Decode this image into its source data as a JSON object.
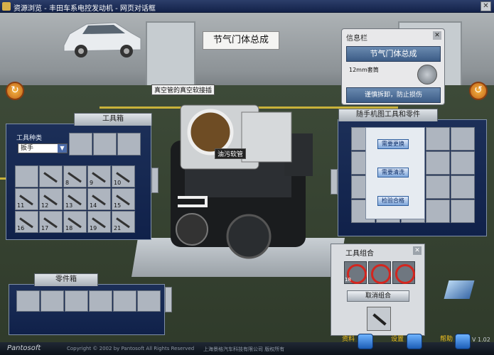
{
  "window": {
    "title": "资源浏览 - 丰田车系电控发动机 - 网页对话框",
    "close_glyph": "✕"
  },
  "assembly_title": "节气门体总成",
  "info_panel": {
    "title": "信息栏",
    "close_glyph": "✕",
    "part_name": "节气门体总成",
    "tool_spec": "12mm套筒",
    "warning": "谨慎拆卸，防止损伤"
  },
  "callouts": {
    "hose": "真空管的真空软接插",
    "connector": "油污软管"
  },
  "icons": {
    "left_round": "refresh-icon",
    "right_round": "rotate-icon"
  },
  "toolbox": {
    "title": "工具箱",
    "type_label": "工具种类",
    "type_selected": "扳手",
    "slot_numbers": [
      "",
      "",
      "8",
      "9",
      "10",
      "11",
      "12",
      "13",
      "14",
      "15",
      "16",
      "17",
      "18",
      "19",
      "21"
    ]
  },
  "hand_panel": {
    "title": "随手机图工具和零件",
    "buttons": [
      "需要更换",
      "需要清洗",
      "检验合格"
    ]
  },
  "parts_box": {
    "title": "零件箱"
  },
  "tool_combo": {
    "title": "工具组合",
    "close_glyph": "✕",
    "cancel_label": "取消组合",
    "slot_number": "18"
  },
  "footer": {
    "brand": "Pantosoft",
    "copyright": "Copyright © 2002 by Pantosoft All Rights Reserved",
    "company": "上海景格汽车科技有限公司 版权所有",
    "version": "V 1.02",
    "materials_label": "资料",
    "settings_label": "设置",
    "help_label": "帮助"
  }
}
